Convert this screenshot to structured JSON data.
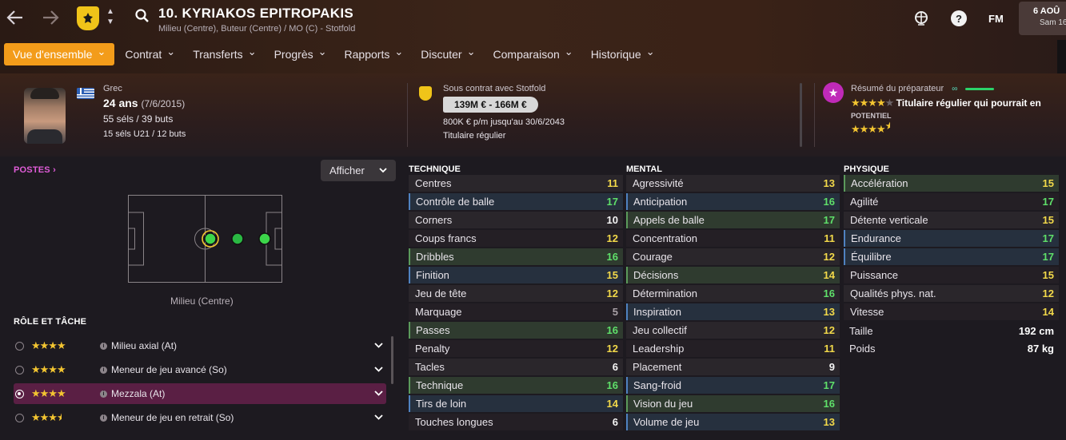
{
  "header": {
    "back_icon": "arrow-left",
    "forward_icon": "arrow-right",
    "player_title": "10. KYRIAKOS EPITROPAKIS",
    "player_subtitle": "Milieu (Centre), Buteur (Centre) / MO (C) - Stotfold",
    "date_line1": "6 AOÛ",
    "date_line2": "Sam 16",
    "fm_label": "FM",
    "help_label": "?"
  },
  "tabs": [
    {
      "label": "Vue d'ensemble",
      "active": true
    },
    {
      "label": "Contrat"
    },
    {
      "label": "Transferts"
    },
    {
      "label": "Progrès"
    },
    {
      "label": "Rapports"
    },
    {
      "label": "Discuter"
    },
    {
      "label": "Comparaison"
    },
    {
      "label": "Historique"
    }
  ],
  "profile": {
    "nationality": "Grec",
    "age": "24 ans",
    "birthdate": "(7/6/2015)",
    "caps": "55 séls / 39 buts",
    "u21": "15 séls U21 / 12 buts"
  },
  "contract": {
    "club_line": "Sous contrat avec Stotfold",
    "value": "139M € - 166M €",
    "wage": "800K € p/m jusqu'au 30/6/2043",
    "status": "Titulaire régulier"
  },
  "scout": {
    "title": "Résumé du préparateur",
    "summary": "Titulaire régulier qui pourrait en",
    "potential_label": "POTENTIEL",
    "current_stars": 4,
    "potential_stars": 4.5
  },
  "positions": {
    "title": "POSTES",
    "display_button": "Afficher",
    "caption": "Milieu (Centre)"
  },
  "roles": {
    "title": "RÔLE ET TÂCHE",
    "items": [
      {
        "stars": 4,
        "name": "Milieu axial (At)",
        "selected": false
      },
      {
        "stars": 4,
        "name": "Meneur de jeu avancé (So)",
        "selected": false
      },
      {
        "stars": 4,
        "name": "Mezzala (At)",
        "selected": true
      },
      {
        "stars": 3.5,
        "name": "Meneur de jeu en retrait (So)",
        "selected": false
      }
    ]
  },
  "technique": {
    "title": "TECHNIQUE",
    "rows": [
      {
        "name": "Centres",
        "value": "11",
        "color": "yellow",
        "hl": ""
      },
      {
        "name": "Contrôle de balle",
        "value": "17",
        "color": "green",
        "hl": "blue"
      },
      {
        "name": "Corners",
        "value": "10",
        "color": "white",
        "hl": ""
      },
      {
        "name": "Coups francs",
        "value": "12",
        "color": "yellow",
        "hl": ""
      },
      {
        "name": "Dribbles",
        "value": "16",
        "color": "green",
        "hl": "green"
      },
      {
        "name": "Finition",
        "value": "15",
        "color": "yellow",
        "hl": "blue"
      },
      {
        "name": "Jeu de tête",
        "value": "12",
        "color": "yellow",
        "hl": ""
      },
      {
        "name": "Marquage",
        "value": "5",
        "color": "grey",
        "hl": ""
      },
      {
        "name": "Passes",
        "value": "16",
        "color": "green",
        "hl": "green"
      },
      {
        "name": "Penalty",
        "value": "12",
        "color": "yellow",
        "hl": ""
      },
      {
        "name": "Tacles",
        "value": "6",
        "color": "white",
        "hl": ""
      },
      {
        "name": "Technique",
        "value": "16",
        "color": "green",
        "hl": "green"
      },
      {
        "name": "Tirs de loin",
        "value": "14",
        "color": "yellow",
        "hl": "blue"
      },
      {
        "name": "Touches longues",
        "value": "6",
        "color": "white",
        "hl": ""
      }
    ]
  },
  "mental": {
    "title": "MENTAL",
    "rows": [
      {
        "name": "Agressivité",
        "value": "13",
        "color": "yellow",
        "hl": ""
      },
      {
        "name": "Anticipation",
        "value": "16",
        "color": "green",
        "hl": "blue"
      },
      {
        "name": "Appels de balle",
        "value": "17",
        "color": "green",
        "hl": "green"
      },
      {
        "name": "Concentration",
        "value": "11",
        "color": "yellow",
        "hl": ""
      },
      {
        "name": "Courage",
        "value": "12",
        "color": "yellow",
        "hl": ""
      },
      {
        "name": "Décisions",
        "value": "14",
        "color": "yellow",
        "hl": "green"
      },
      {
        "name": "Détermination",
        "value": "16",
        "color": "green",
        "hl": ""
      },
      {
        "name": "Inspiration",
        "value": "13",
        "color": "yellow",
        "hl": "blue"
      },
      {
        "name": "Jeu collectif",
        "value": "12",
        "color": "yellow",
        "hl": ""
      },
      {
        "name": "Leadership",
        "value": "11",
        "color": "yellow",
        "hl": ""
      },
      {
        "name": "Placement",
        "value": "9",
        "color": "white",
        "hl": ""
      },
      {
        "name": "Sang-froid",
        "value": "17",
        "color": "green",
        "hl": "blue"
      },
      {
        "name": "Vision du jeu",
        "value": "16",
        "color": "green",
        "hl": "green"
      },
      {
        "name": "Volume de jeu",
        "value": "13",
        "color": "yellow",
        "hl": "blue"
      }
    ]
  },
  "physique": {
    "title": "PHYSIQUE",
    "rows": [
      {
        "name": "Accélération",
        "value": "15",
        "color": "yellow",
        "hl": "green"
      },
      {
        "name": "Agilité",
        "value": "17",
        "color": "green",
        "hl": ""
      },
      {
        "name": "Détente verticale",
        "value": "15",
        "color": "yellow",
        "hl": ""
      },
      {
        "name": "Endurance",
        "value": "17",
        "color": "green",
        "hl": "blue"
      },
      {
        "name": "Équilibre",
        "value": "17",
        "color": "green",
        "hl": "blue"
      },
      {
        "name": "Puissance",
        "value": "15",
        "color": "yellow",
        "hl": ""
      },
      {
        "name": "Qualités phys. nat.",
        "value": "12",
        "color": "yellow",
        "hl": ""
      },
      {
        "name": "Vitesse",
        "value": "14",
        "color": "yellow",
        "hl": ""
      }
    ],
    "height_label": "Taille",
    "height_value": "192 cm",
    "weight_label": "Poids",
    "weight_value": "87 kg"
  },
  "colors": {
    "accent_orange": "#f39c1a",
    "scout_badge": "#c02ab8",
    "attr_green": "#5fe06a",
    "attr_yellow": "#f2d94a"
  }
}
